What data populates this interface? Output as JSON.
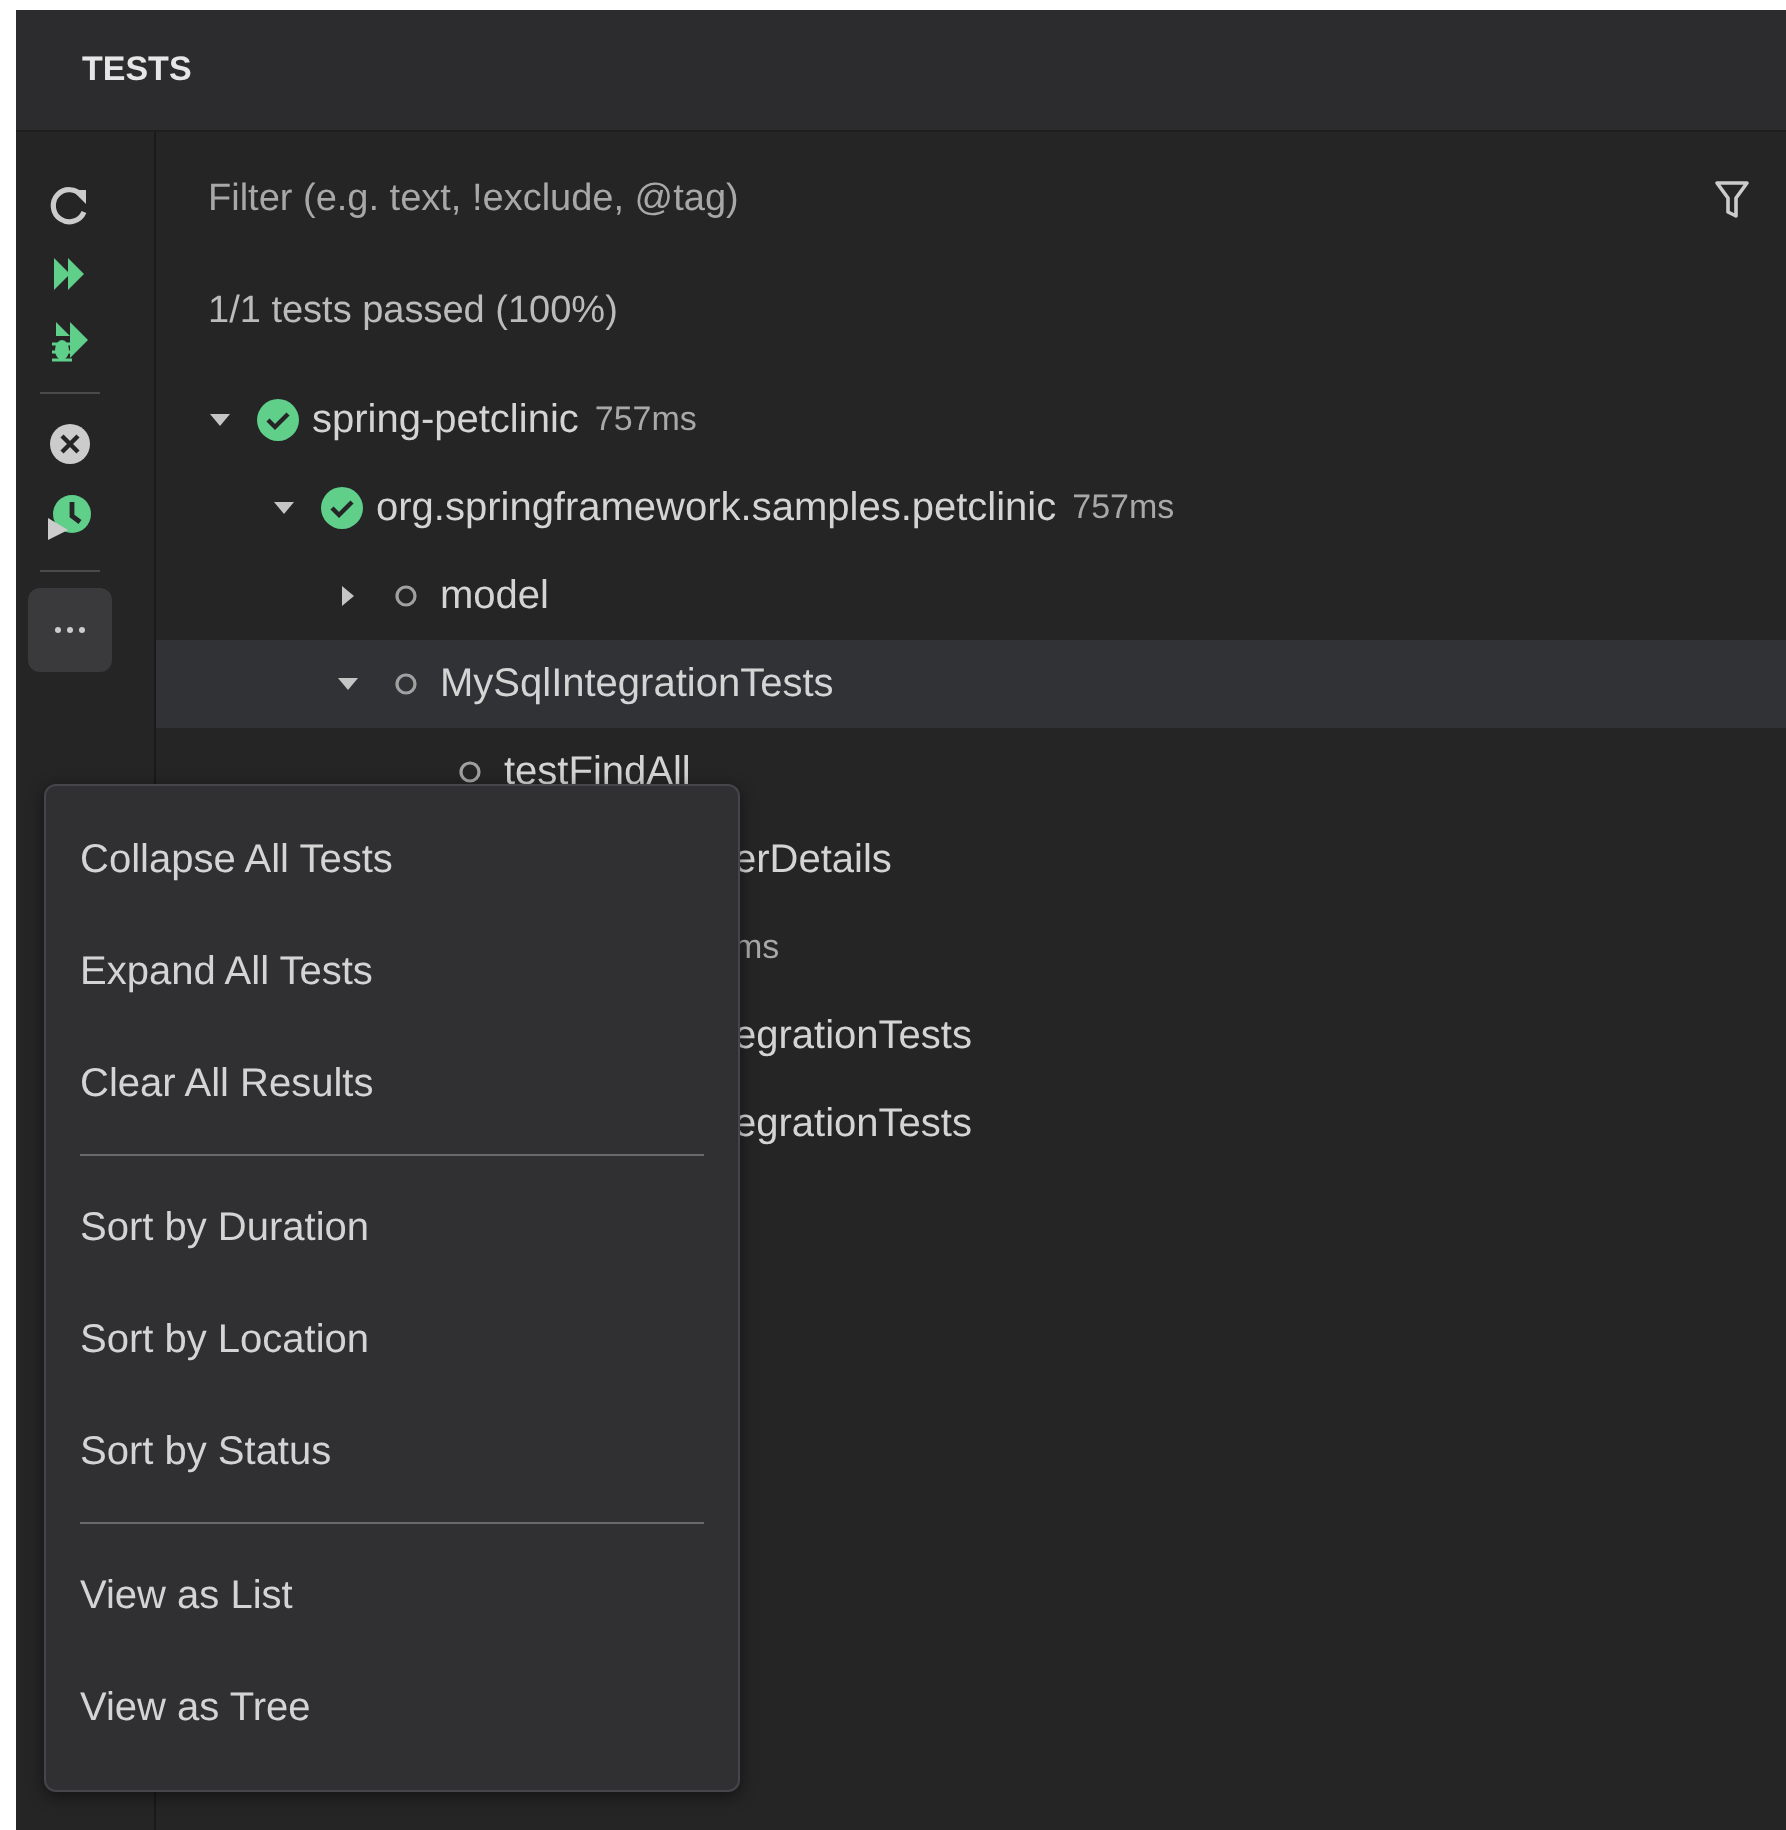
{
  "panel": {
    "title": "TESTS"
  },
  "toolbar": [
    {
      "kind": "refresh"
    },
    {
      "kind": "run-all"
    },
    {
      "kind": "debug-all"
    },
    {
      "kind": "separator"
    },
    {
      "kind": "cancel"
    },
    {
      "kind": "run-history"
    },
    {
      "kind": "separator"
    },
    {
      "kind": "more",
      "selected": true
    }
  ],
  "filter": {
    "placeholder": "Filter (e.g. text, !exclude, @tag)"
  },
  "summary": "1/1 tests passed (100%)",
  "tree": [
    {
      "label": "spring-petclinic",
      "duration": "757ms",
      "passed": true,
      "expanded": true,
      "selected": false,
      "children": [
        {
          "label": "org.springframework.samples.petclinic",
          "duration": "757ms",
          "passed": true,
          "expanded": true,
          "selected": false,
          "children": [
            {
              "label": "model",
              "passed": false,
              "expanded": false,
              "selected": false
            },
            {
              "label": "MySqlIntegrationTests",
              "passed": false,
              "expanded": true,
              "selected": true,
              "children": [
                {
                  "label": "testFindAll",
                  "passed": false,
                  "selected": false
                }
              ]
            }
          ]
        }
      ]
    }
  ],
  "rows_behind_menu": [
    {
      "text": "erDetails",
      "kind": "label"
    },
    {
      "text": "ms",
      "kind": "duration"
    },
    {
      "text": "egrationTests",
      "kind": "label"
    },
    {
      "text": "egrationTests",
      "kind": "label"
    }
  ],
  "menu": [
    [
      {
        "label": "Collapse All Tests"
      },
      {
        "label": "Expand All Tests"
      },
      {
        "label": "Clear All Results"
      }
    ],
    [
      {
        "label": "Sort by Duration"
      },
      {
        "label": "Sort by Location"
      },
      {
        "label": "Sort by Status"
      }
    ],
    [
      {
        "label": "View as List"
      },
      {
        "label": "View as Tree"
      }
    ]
  ]
}
